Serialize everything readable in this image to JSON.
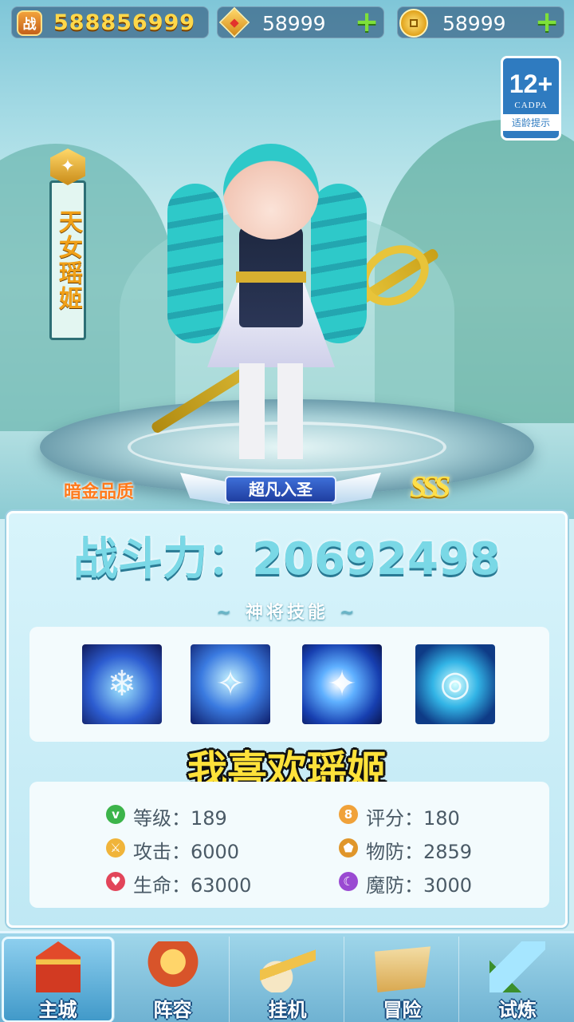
{
  "currency": {
    "power_icon_label": "战",
    "power_value": "588856999",
    "gem_amount": "58999",
    "coin_amount": "58999",
    "plus_symbol": "+"
  },
  "age_rating": {
    "value": "12+",
    "org": "CADPA",
    "tip": "适龄提示"
  },
  "hero": {
    "name": "天女瑶姬",
    "quality_label": "暗金品质",
    "rank_label": "超凡入圣",
    "grade": "SSS"
  },
  "panel": {
    "combat_power_text": "战斗力：20692498",
    "skills_header": "神将技能",
    "skills": [
      {
        "icon": "ice-crystal-skill-icon"
      },
      {
        "icon": "phoenix-skill-icon"
      },
      {
        "icon": "light-burst-skill-icon"
      },
      {
        "icon": "water-swirl-skill-icon"
      }
    ],
    "caption": "我喜欢瑶姬",
    "stats": [
      {
        "label": "等级",
        "value": "189",
        "text": "等级：189",
        "icon": "level-icon",
        "color": "#3cb44a",
        "glyph": "v"
      },
      {
        "label": "评分",
        "value": "180",
        "text": "评分：180",
        "icon": "score-icon",
        "color": "#f0a23a",
        "glyph": "8"
      },
      {
        "label": "攻击",
        "value": "6000",
        "text": "攻击：6000",
        "icon": "attack-icon",
        "color": "#f0b43a",
        "glyph": "⚔"
      },
      {
        "label": "物防",
        "value": "2859",
        "text": "物防：2859",
        "icon": "physical-defense-icon",
        "color": "#e0962a",
        "glyph": "⬟"
      },
      {
        "label": "生命",
        "value": "63000",
        "text": "生命：63000",
        "icon": "health-icon",
        "color": "#e2455a",
        "glyph": "♥"
      },
      {
        "label": "魔防",
        "value": "3000",
        "text": "魔防：3000",
        "icon": "magic-defense-icon",
        "color": "#9a4ad2",
        "glyph": "☾"
      }
    ]
  },
  "nav": {
    "items": [
      {
        "label": "主城",
        "icon": "main-city-icon",
        "active": true
      },
      {
        "label": "阵容",
        "icon": "lineup-icon",
        "active": false
      },
      {
        "label": "挂机",
        "icon": "idle-icon",
        "active": false
      },
      {
        "label": "冒险",
        "icon": "adventure-icon",
        "active": false
      },
      {
        "label": "试炼",
        "icon": "trial-icon",
        "active": false
      }
    ]
  }
}
